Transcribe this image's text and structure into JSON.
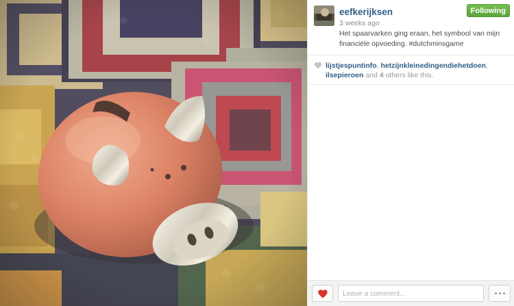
{
  "post": {
    "username": "eefkerijksen",
    "follow_label": "Following",
    "time": "3 weeks ago",
    "caption": "Het spaarvarken ging eraan, het symbool van mijn financiële opvoeding. #dutchminsgame"
  },
  "likes": {
    "users": [
      "lijstjespuntinfo",
      "hetzijnkleinedingendiehetdoen",
      "ilsepieroen"
    ],
    "separator_1": ", ",
    "separator_2": ", ",
    "and_text": " and ",
    "others_count": "4",
    "others_suffix": " others like this."
  },
  "comment_box": {
    "placeholder": "Leave a comment..."
  },
  "icons": {
    "like_heart": "heart-icon",
    "likes_heart": "heart-icon",
    "more": "ellipsis-icon"
  },
  "colors": {
    "username": "#2e5e86",
    "follow_button": "#6bb34a",
    "heart_active": "#d8332a",
    "heart_inactive": "#c4c4c4"
  }
}
